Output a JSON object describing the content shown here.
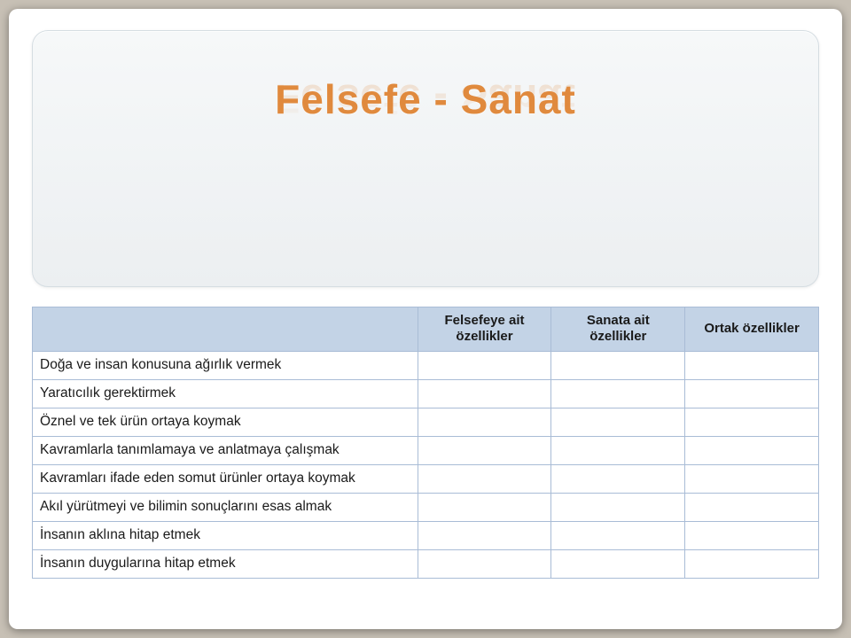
{
  "title": "Felsefe - Sanat",
  "columns": {
    "row_label": "",
    "c1": "Felsefeye ait özellikler",
    "c2": "Sanata ait özellikler",
    "c3": "Ortak özellikler"
  },
  "rows": [
    {
      "label": "Doğa ve insan konusuna ağırlık vermek",
      "c1": "",
      "c2": "",
      "c3": ""
    },
    {
      "label": "Yaratıcılık gerektirmek",
      "c1": "",
      "c2": "",
      "c3": ""
    },
    {
      "label": "Öznel ve tek ürün ortaya koymak",
      "c1": "",
      "c2": "",
      "c3": ""
    },
    {
      "label": "Kavramlarla tanımlamaya ve anlatmaya çalışmak",
      "c1": "",
      "c2": "",
      "c3": ""
    },
    {
      "label": "Kavramları ifade eden somut ürünler ortaya koymak",
      "c1": "",
      "c2": "",
      "c3": ""
    },
    {
      "label": "Akıl yürütmeyi ve bilimin sonuçlarını esas almak",
      "c1": "",
      "c2": "",
      "c3": ""
    },
    {
      "label": "İnsanın aklına hitap etmek",
      "c1": "",
      "c2": "",
      "c3": ""
    },
    {
      "label": "İnsanın duygularına hitap etmek",
      "c1": "",
      "c2": "",
      "c3": ""
    }
  ]
}
